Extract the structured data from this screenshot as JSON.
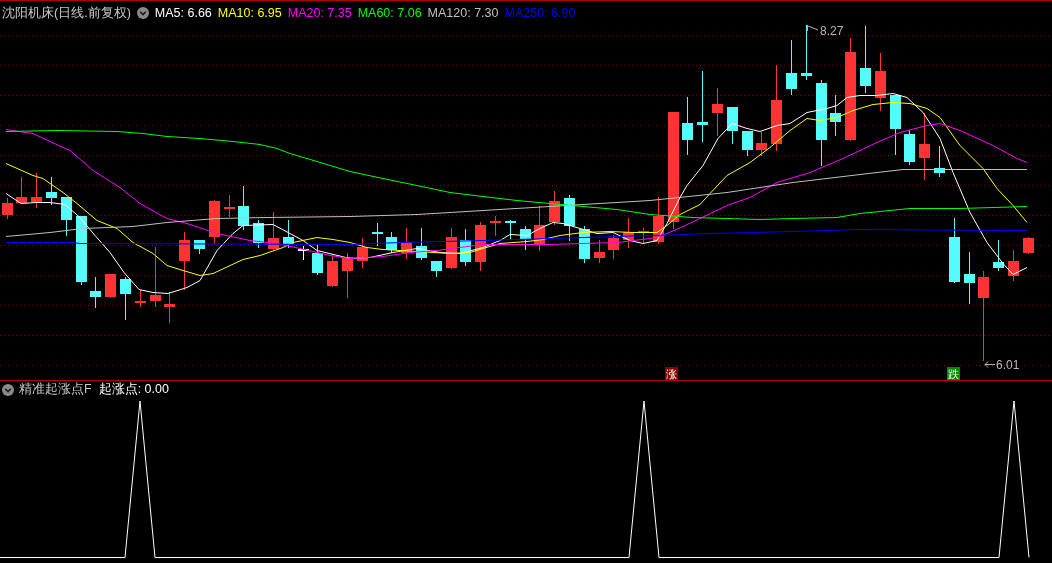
{
  "price_panel": {
    "title": "沈阳机床(日线.前复权)",
    "legend": [
      {
        "label": "MA5: 6.66",
        "color": "#ffffff"
      },
      {
        "label": "MA10: 6.95",
        "color": "#ffff00"
      },
      {
        "label": "MA20: 7.35",
        "color": "#ff00ff"
      },
      {
        "label": "MA60: 7.06",
        "color": "#00ff00"
      },
      {
        "label": "MA120: 7.30",
        "color": "#c0c0c0"
      },
      {
        "label": "MA250: 6.90",
        "color": "#0000ff"
      }
    ],
    "high_label": "8.27",
    "low_label": "6.01",
    "signals": [
      {
        "label": "涨",
        "kind": "rise"
      },
      {
        "label": "跌",
        "kind": "fall"
      }
    ]
  },
  "indicator_panel": {
    "title": "精准起涨点F",
    "reading": "起涨点: 0.00"
  }
}
